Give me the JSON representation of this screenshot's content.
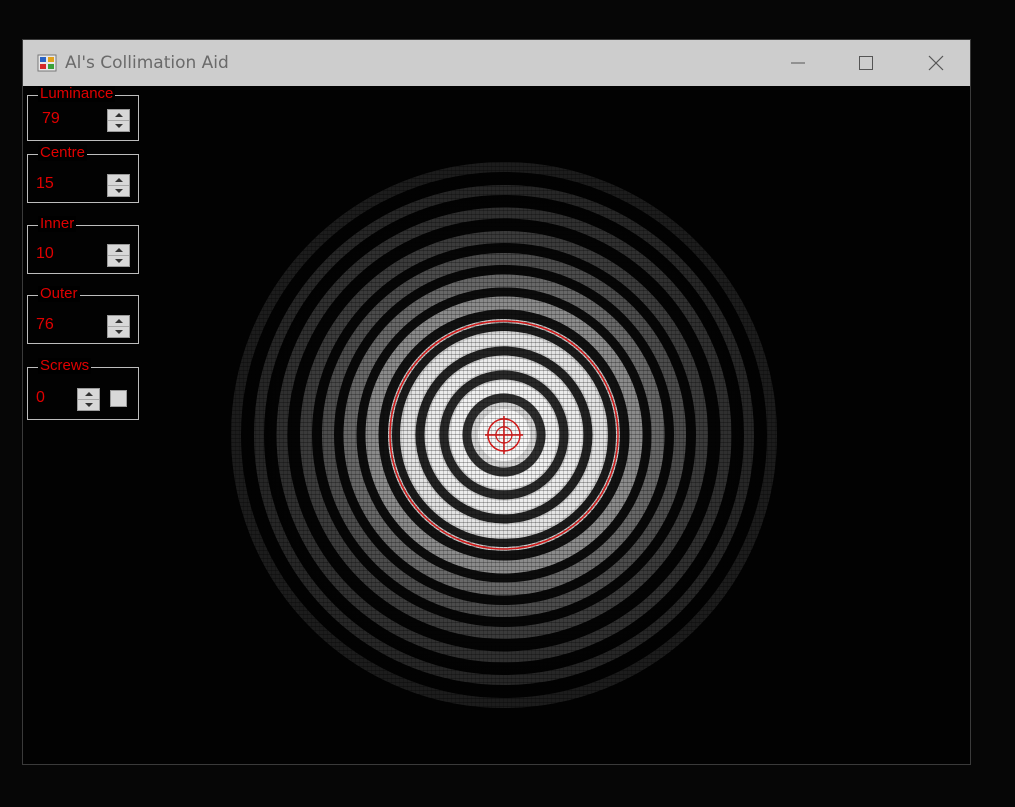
{
  "window": {
    "title": "Al's Collimation Aid",
    "controls": {
      "minimize": "minimize-icon",
      "maximize": "maximize-icon",
      "close": "close-icon"
    }
  },
  "controls": {
    "luminance": {
      "label": "Luminance",
      "value": "79"
    },
    "centre": {
      "label": "Centre",
      "value": "15"
    },
    "inner": {
      "label": "Inner",
      "value": "10"
    },
    "outer": {
      "label": "Outer",
      "value": "76"
    },
    "screws": {
      "label": "Screws",
      "value": "0",
      "checked": false
    }
  },
  "colors": {
    "accent": "#e00000",
    "titlebar": "#cdcdcd",
    "background": "#000000",
    "overlay_circle": "#d01818"
  },
  "display": {
    "icon": "star-diffraction-image",
    "overlay": "outer-circle-and-crosshair"
  }
}
